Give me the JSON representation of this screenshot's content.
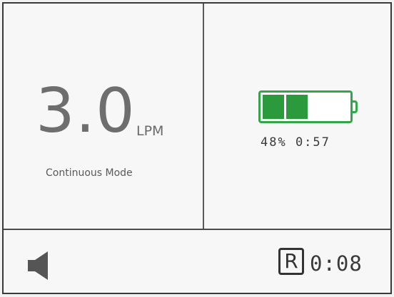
{
  "flow": {
    "value": "3.0",
    "unit": "LPM",
    "mode": "Continuous Mode"
  },
  "battery": {
    "percent_text": "48% 0:57",
    "level": 0.48,
    "fill_color": "#2a9a3c",
    "outline_color": "#33a64a"
  },
  "footer": {
    "volume_icon": "speaker-icon",
    "r_badge": "R",
    "timer": "0:08"
  }
}
